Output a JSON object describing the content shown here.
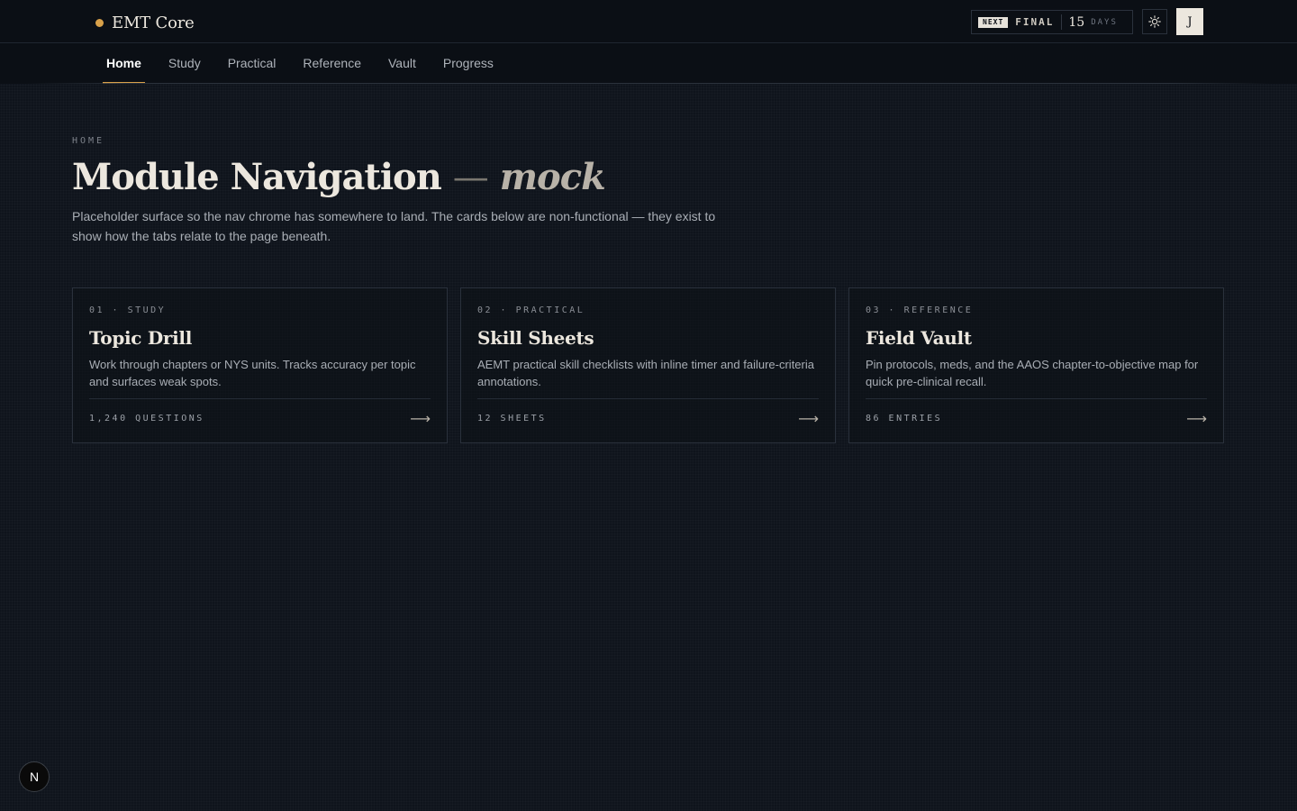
{
  "brand": {
    "name": "EMT Core",
    "dot_color": "#d9a14a"
  },
  "countdown": {
    "tag": "NEXT",
    "label": "FINAL",
    "days": "15",
    "days_label": "DAYS"
  },
  "theme_toggle": {
    "icon": "sun-icon"
  },
  "avatar": {
    "initial": "J"
  },
  "nav": {
    "tabs": [
      {
        "label": "Home",
        "active": true
      },
      {
        "label": "Study",
        "active": false
      },
      {
        "label": "Practical",
        "active": false
      },
      {
        "label": "Reference",
        "active": false
      },
      {
        "label": "Vault",
        "active": false
      },
      {
        "label": "Progress",
        "active": false
      }
    ],
    "accent": "#d9a14a"
  },
  "main": {
    "breadcrumb": "HOME",
    "title": "Module Navigation",
    "title_dash": "—",
    "title_suffix": "mock",
    "description": "Placeholder surface so the nav chrome has somewhere to land. The cards below are non-functional — they exist to show how the tabs relate to the page beneath.",
    "cards": [
      {
        "eyebrow": "01 · STUDY",
        "title": "Topic Drill",
        "description": "Work through chapters or NYS units. Tracks accuracy per topic and surfaces weak spots.",
        "meta": "1,240 QUESTIONS",
        "arrow": "⟶"
      },
      {
        "eyebrow": "02 · PRACTICAL",
        "title": "Skill Sheets",
        "description": "AEMT practical skill checklists with inline timer and failure-criteria annotations.",
        "meta": "12 SHEETS",
        "arrow": "⟶"
      },
      {
        "eyebrow": "03 · REFERENCE",
        "title": "Field Vault",
        "description": "Pin protocols, meds, and the AAOS chapter-to-objective map for quick pre-clinical recall.",
        "meta": "86 ENTRIES",
        "arrow": "⟶"
      }
    ]
  },
  "corner_badge": {
    "letter": "N"
  }
}
